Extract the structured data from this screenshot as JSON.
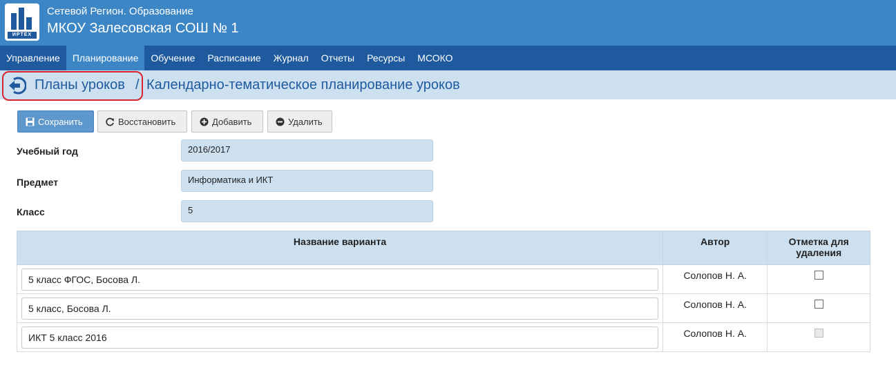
{
  "header": {
    "logo_text": "ИРТЕХ",
    "system_name": "Сетевой Регион. Образование",
    "school_name": "МКОУ Залесовская СОШ № 1"
  },
  "nav": {
    "items": [
      {
        "label": "Управление",
        "active": false
      },
      {
        "label": "Планирование",
        "active": true
      },
      {
        "label": "Обучение",
        "active": false
      },
      {
        "label": "Расписание",
        "active": false
      },
      {
        "label": "Журнал",
        "active": false
      },
      {
        "label": "Отчеты",
        "active": false
      },
      {
        "label": "Ресурсы",
        "active": false
      },
      {
        "label": "МСОКО",
        "active": false
      }
    ]
  },
  "breadcrumb": {
    "parent": "Планы уроков",
    "separator": "/",
    "current": "Календарно-тематическое планирование уроков"
  },
  "toolbar": {
    "save_label": "Сохранить",
    "restore_label": "Восстановить",
    "add_label": "Добавить",
    "delete_label": "Удалить"
  },
  "form": {
    "year_label": "Учебный год",
    "year_value": "2016/2017",
    "subject_label": "Предмет",
    "subject_value": "Информатика и ИКТ",
    "class_label": "Класс",
    "class_value": "5"
  },
  "table": {
    "headers": {
      "name": "Название варианта",
      "author": "Автор",
      "mark_line1": "Отметка для",
      "mark_line2": "удаления"
    },
    "rows": [
      {
        "name": "5 класс ФГОС, Босова Л.",
        "author": "Солопов Н. А.",
        "checked": false,
        "disabled": false
      },
      {
        "name": "5 класс, Босова Л.",
        "author": "Солопов Н. А.",
        "checked": false,
        "disabled": false
      },
      {
        "name": "ИКТ 5 класс 2016",
        "author": "Солопов Н. А.",
        "checked": false,
        "disabled": true
      }
    ]
  },
  "colors": {
    "header_bg": "#3c86c6",
    "nav_bg": "#1f5a9e",
    "nav_active_bg": "#3c86c6",
    "breadcrumb_bg": "#cde0f0",
    "highlight": "#d9232f",
    "primary_button": "#5e97cc"
  },
  "icons": {
    "back": "arrow-left-circle-icon",
    "save": "save-icon",
    "restore": "refresh-icon",
    "add": "plus-circle-icon",
    "delete": "minus-circle-icon"
  }
}
